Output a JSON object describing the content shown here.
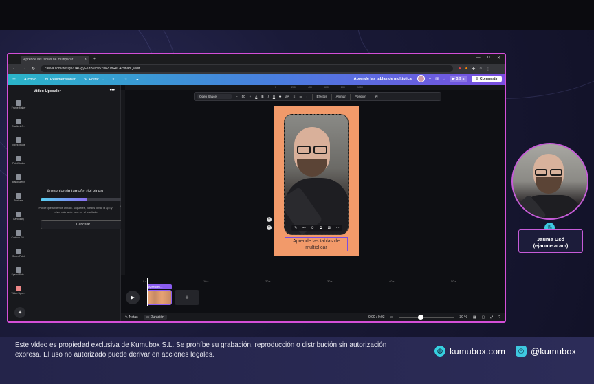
{
  "browser": {
    "tab_title": "Aprende las tablas de multiplicar",
    "tab_close": "×",
    "new_tab": "+",
    "url": "canva.com/design/DAGgyF7dB9/c05YbkZ1bRkLAc9na8Q/edit",
    "window_controls": [
      "—",
      "⧉",
      "✕"
    ]
  },
  "canva": {
    "menu_icon": "☰",
    "file_menu": "Archivo",
    "resize": "Redimensionar",
    "edit": "Editar",
    "project_title": "Aprende las tablas de multiplicar",
    "duration": "3.9 s",
    "share": "Compartir",
    "rail": [
      "Frame Maker",
      "Gradient G...",
      "TypeExtrude",
      "PointStudio",
      "BrandSketch",
      "Reshape",
      "Cartoonify",
      "Cartoon Filt...",
      "SpeedPaint",
      "Speed Pain...",
      "Video Upsc..."
    ],
    "panel": {
      "title": "Vídeo Upscaler",
      "more": "•••",
      "status": "Aumentando tamaño del vídeo",
      "progress": 0.55,
      "note": "Puede que tardemos un rato. Si quieres, puedes cerrar la app y volver más tarde para ver el resultado.",
      "cancel": "Cancelar"
    },
    "ruler": [
      "0",
      "200",
      "400",
      "600",
      "800",
      "1000"
    ],
    "toolbar": {
      "font": "Open Sauce",
      "minus": "−",
      "size": "50",
      "plus": "+",
      "bold": "B",
      "italic": "I",
      "underline": "U",
      "strike": "S",
      "case": "aA",
      "effects": "Efectos",
      "animate": "Animar",
      "position": "Posición"
    },
    "caption_line1": "Aprende las tablas de",
    "caption_line2": "multiplicar",
    "timeline": {
      "ticks": [
        "0 s",
        "10 s",
        "20 s",
        "30 s",
        "40 s",
        "50 s"
      ],
      "clip_label": "Aprende l...",
      "add": "+"
    },
    "status": {
      "notes": "Notas",
      "duration": "Duración",
      "time": "0:00 / 0:03",
      "zoom": "30 %"
    }
  },
  "overlay": {
    "presenter_name": "Jaume Usó",
    "presenter_handle": "(ejaume.aram)",
    "disclaimer": "Este vídeo es propiedad exclusiva de Kumubox S.L. Se prohíbe su grabación, reproducción o distribución sin autorización expresa. El uso no autorizado puede derivar en acciones legales.",
    "website": "kumubox.com",
    "social": "@kumubox"
  }
}
